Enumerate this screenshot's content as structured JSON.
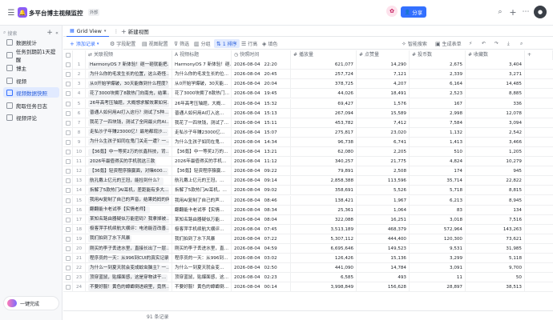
{
  "app": {
    "title": "多平台博主视频监控",
    "badge": "外部",
    "share_label": "分享",
    "search_placeholder": "搜索"
  },
  "sidebar": {
    "items": [
      {
        "label": "数据统计",
        "active": false
      },
      {
        "label": "任务到期前1天提醒",
        "active": false
      },
      {
        "label": "博主",
        "active": false
      },
      {
        "label": "视频",
        "active": false
      },
      {
        "label": "视频数据快照",
        "active": true
      },
      {
        "label": "爬取任务日志",
        "active": false
      },
      {
        "label": "视频评论",
        "active": false
      }
    ],
    "footer_button": "一键完成"
  },
  "view_tabs": {
    "grid_view": "Grid View",
    "new_view": "新建视图"
  },
  "toolbar": {
    "add_record": "添加记录",
    "field_config": "字段配置",
    "view_config": "视图配置",
    "filter": "筛选",
    "group": "分组",
    "sort": "1 排序",
    "row_height": "行高",
    "fill_color": "填色",
    "smart_query": "智能搜索",
    "gen_form": "生成表单"
  },
  "columns": {
    "related_video": "关联视频",
    "video_title": "视频标题",
    "snapshot_time": "快照时间",
    "plays": "播放量",
    "likes": "点赞量",
    "coins": "投币数",
    "favorites": "收藏数"
  },
  "rows": [
    {
      "n": "1",
      "rel": "HarmonyOS 7 新体验！砸一砸就能把…",
      "title": "HarmonyOS 7 新体验！砸…",
      "date": "2026-08-04",
      "time": "22:20",
      "plays": "621,077",
      "likes": "14,290",
      "coins": "2,675",
      "fav": "3,404"
    },
    {
      "n": "2",
      "rel": "为什么你的毛发生长的位置，这么奇怪…",
      "title": "为什么你的毛发生长的位…",
      "date": "2026-08-04",
      "time": "20:45",
      "plays": "257,724",
      "likes": "7,121",
      "coins": "2,339",
      "fav": "3,271"
    },
    {
      "n": "3",
      "rel": "从0开始学爆破，30天能做到什么程度？",
      "title": "从0开始学爆破，30天能…",
      "date": "2026-08-04",
      "time": "20:04",
      "plays": "378,725",
      "likes": "4,207",
      "coins": "6,164",
      "fav": "14,485"
    },
    {
      "n": "4",
      "rel": "花了3000块拥了8款热门向南充，结果…",
      "title": "花了3000块拥了8款热门…",
      "date": "2026-08-04",
      "time": "19:45",
      "plays": "44,026",
      "likes": "18,491",
      "coins": "2,523",
      "fav": "8,885"
    },
    {
      "n": "5",
      "rel": "26年高考压轴题，大概想求解效果如何…",
      "title": "26年高考压轴题，大概…",
      "date": "2026-08-04",
      "time": "15:32",
      "plays": "69,427",
      "likes": "1,576",
      "coins": "167",
      "fav": "336"
    },
    {
      "n": "6",
      "rel": "普通人如何用AI打入这行？测试了5种…",
      "title": "普通人如何用AI打入这…",
      "date": "2026-08-04",
      "time": "15:13",
      "plays": "267,094",
      "likes": "15,589",
      "coins": "2,998",
      "fav": "12,078"
    },
    {
      "n": "7",
      "rel": "我花了一四块钱，测试了全网最火的AI…",
      "title": "我花了一四块钱，测试了…",
      "date": "2026-08-04",
      "time": "15:11",
      "plays": "453,782",
      "likes": "7,412",
      "coins": "7,584",
      "fav": "3,094"
    },
    {
      "n": "8",
      "rel": "走私沙子年赚23000亿！最地都现沙…",
      "title": "走私沙子年赚23000亿…",
      "date": "2026-08-04",
      "time": "15:07",
      "plays": "275,817",
      "likes": "23,020",
      "coins": "1,132",
      "fav": "2,542"
    },
    {
      "n": "9",
      "rel": "为什么生孩子如同在鬼门关走一遭？一…",
      "title": "为什么生孩子如同在鬼…",
      "date": "2026-08-04",
      "time": "14:34",
      "plays": "96,738",
      "likes": "6,741",
      "coins": "1,413",
      "fav": "3,466"
    },
    {
      "n": "10",
      "rel": "【36氪】中一等奖2万的长鑫科技，背…",
      "title": "【36氪】中一等奖2万的…",
      "date": "2026-08-04",
      "time": "13:21",
      "plays": "62,080",
      "likes": "2,205",
      "coins": "510",
      "fav": "1,205"
    },
    {
      "n": "11",
      "rel": "2026年最值得买的手机就这三款",
      "title": "2026年最值得买的手机…",
      "date": "2026-08-04",
      "time": "11:12",
      "plays": "340,257",
      "likes": "21,775",
      "coins": "4,824",
      "fav": "10,279"
    },
    {
      "n": "12",
      "rel": "【36氪】轻资程序猿赢面，对赌600…",
      "title": "【36氪】轻资程序猿赢…",
      "date": "2026-08-04",
      "time": "09:22",
      "plays": "79,891",
      "likes": "2,508",
      "coins": "174",
      "fav": "945"
    },
    {
      "n": "13",
      "rel": "航孔戴上亿元的王冠，能捡到什么？",
      "title": "航孔戴上亿元的王冠，…",
      "date": "2026-08-04",
      "time": "09:14",
      "plays": "2,858,388",
      "likes": "113,596",
      "coins": "35,714",
      "fav": "22,822"
    },
    {
      "n": "14",
      "rel": "拆解了5款热门AI耳机，差距能有多大…",
      "title": "拆解了5款热门AI耳机，…",
      "date": "2026-08-04",
      "time": "09:02",
      "plays": "358,691",
      "likes": "5,526",
      "coins": "5,718",
      "fav": "8,815"
    },
    {
      "n": "15",
      "rel": "我用AI复制了自己的声音，结果妈妈的网…",
      "title": "我用AI复制了自己的声…",
      "date": "2026-08-04",
      "time": "08:46",
      "plays": "138,421",
      "likes": "1,967",
      "coins": "6,213",
      "fav": "8,945"
    },
    {
      "n": "16",
      "rel": "翻翻能卡老试李【实情老师】",
      "title": "翻翻能卡老试李【实情…",
      "date": "2026-08-04",
      "time": "08:34",
      "plays": "25,361",
      "likes": "1,064",
      "coins": "83",
      "fav": "134"
    },
    {
      "n": "17",
      "rel": "某知名路由器疑似万能密码？我拿掉被…",
      "title": "某知名路由器疑似万能…",
      "date": "2026-08-04",
      "time": "08:04",
      "plays": "322,088",
      "likes": "16,251",
      "coins": "3,018",
      "fav": "7,516"
    },
    {
      "n": "18",
      "rel": "极客萍手机续航大横评：电池能否改善…",
      "title": "极客萍手机续航大横评…",
      "date": "2026-08-04",
      "time": "07:45",
      "plays": "3,513,189",
      "likes": "468,379",
      "coins": "572,964",
      "fav": "143,263"
    },
    {
      "n": "19",
      "rel": "我们拍到了水下风暴",
      "title": "我们拍到了水下风暴",
      "date": "2026-08-04",
      "time": "07:22",
      "plays": "5,307,112",
      "likes": "444,400",
      "coins": "120,300",
      "fav": "73,621"
    },
    {
      "n": "20",
      "rel": "刚买的李子丢进水里，直接长出了一层…",
      "title": "刚买的李子丢进水里，直…",
      "date": "2026-08-04",
      "time": "04:59",
      "plays": "6,695,646",
      "likes": "149,523",
      "coins": "9,531",
      "fav": "31,985"
    },
    {
      "n": "21",
      "rel": "程序员的一天：从996到CUI的真实记录",
      "title": "程序员的一天：从996到…",
      "date": "2026-08-04",
      "time": "03:02",
      "plays": "126,426",
      "likes": "15,136",
      "coins": "3,299",
      "fav": "5,118"
    },
    {
      "n": "22",
      "rel": "为什么一到夏天就会变成蚊虫脑主？一…",
      "title": "为什么一到夏天就会变…",
      "date": "2026-08-04",
      "time": "02:50",
      "plays": "441,090",
      "likes": "14,784",
      "coins": "3,091",
      "fav": "9,700"
    },
    {
      "n": "23",
      "rel": "顶穿蓝鼠，贴爆面感，这是穿物讲干…",
      "title": "顶穿蓝鼠，贴爆面感，这…",
      "date": "2026-08-04",
      "time": "02:23",
      "plays": "6,585",
      "likes": "493",
      "coins": "11",
      "fav": "50"
    },
    {
      "n": "24",
      "rel": "不要好服！黄色的蟑螂倒进碗里，竟然…",
      "title": "不要好服！黄色的蟑螂倒…",
      "date": "2026-08-04",
      "time": "00:14",
      "plays": "3,998,849",
      "likes": "156,628",
      "coins": "28,897",
      "fav": "38,513"
    }
  ],
  "status": {
    "count": "91 条记录"
  },
  "colors": {
    "accent": "#3370ff",
    "active_bg": "#e1eaff"
  }
}
